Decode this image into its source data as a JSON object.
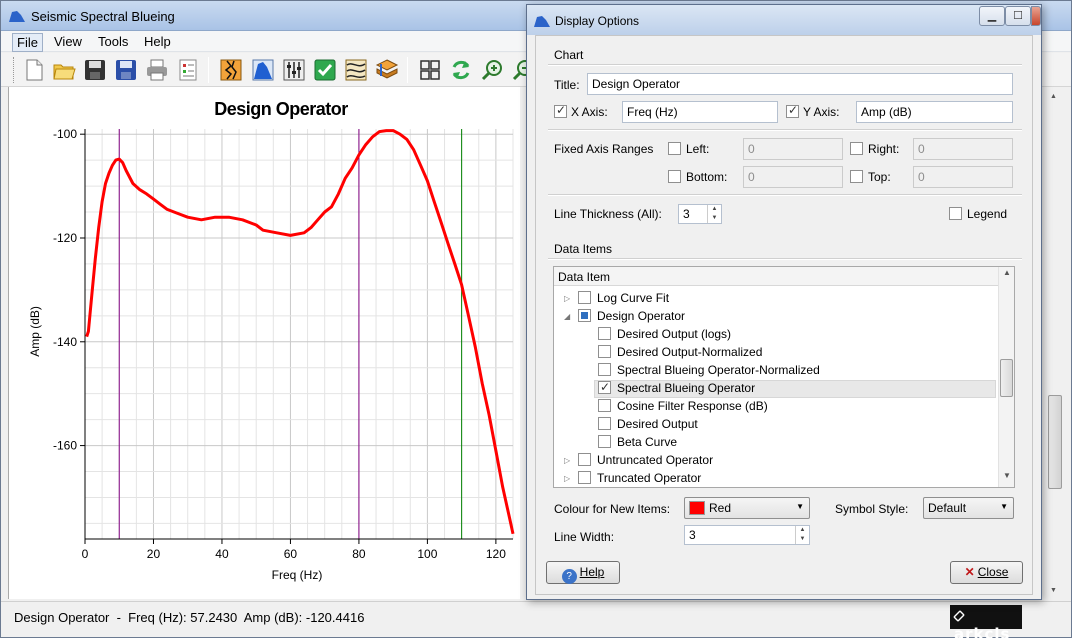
{
  "window": {
    "title": "Seismic Spectral Blueing"
  },
  "menu": {
    "file": "File",
    "view": "View",
    "tools": "Tools",
    "help": "Help"
  },
  "toolbar": {
    "buttons": [
      "new-file-icon",
      "open-folder-icon",
      "save-icon",
      "save-as-icon",
      "print-icon",
      "properties-icon",
      "seismic-trace-icon",
      "spectrum-icon",
      "sliders-icon",
      "checkmark-icon",
      "curves-icon",
      "layers-icon",
      "grid-view-icon",
      "refresh-icon",
      "zoom-in-icon",
      "zoom-out-icon"
    ]
  },
  "chart_data": {
    "type": "line",
    "title": "Design Operator",
    "xlabel": "Freq (Hz)",
    "ylabel": "Amp (dB)",
    "xlim": [
      0,
      125
    ],
    "ylim": [
      -178,
      -99
    ],
    "xticks": [
      0,
      20,
      40,
      60,
      80,
      100,
      120
    ],
    "yticks": [
      -100,
      -120,
      -140,
      -160
    ],
    "grid": true,
    "vlines": [
      {
        "x": 0,
        "color": "#800080"
      },
      {
        "x": 10,
        "color": "#800080"
      },
      {
        "x": 80,
        "color": "#800080"
      },
      {
        "x": 110,
        "color": "#008000"
      }
    ],
    "series": [
      {
        "color": "#ff0000",
        "x": [
          0.5,
          1,
          2,
          3,
          4,
          5,
          6,
          7,
          8,
          9,
          10,
          11,
          12,
          14,
          16,
          18,
          20,
          22,
          24,
          26,
          28,
          30,
          34,
          38,
          42,
          46,
          50,
          52,
          56,
          60,
          64,
          66,
          68,
          70,
          72,
          74,
          76,
          78,
          80,
          82,
          84,
          86,
          88,
          90,
          92,
          94,
          96,
          98,
          100,
          102,
          104,
          106,
          108,
          110,
          112,
          114,
          116,
          118,
          120,
          122,
          124,
          125
        ],
        "y": [
          -139,
          -138,
          -131,
          -124,
          -118,
          -113,
          -109.5,
          -107.5,
          -106,
          -105,
          -104.8,
          -105.5,
          -107,
          -109.5,
          -110.7,
          -111.5,
          -112.5,
          -113.5,
          -114.5,
          -115,
          -115.5,
          -116,
          -116.5,
          -116,
          -116,
          -116.5,
          -117.5,
          -118.5,
          -119,
          -119.5,
          -119,
          -118,
          -116.5,
          -115,
          -114,
          -111.5,
          -108.5,
          -106.5,
          -104,
          -102,
          -100.5,
          -99.5,
          -99.3,
          -99.3,
          -100,
          -101,
          -103,
          -106,
          -109,
          -113,
          -117,
          -121,
          -125,
          -129,
          -135,
          -141,
          -148,
          -154,
          -161,
          -168,
          -174,
          -177
        ]
      }
    ]
  },
  "status": {
    "text": "Design Operator  -  Freq (Hz): 57.2430  Amp (dB): -120.4416"
  },
  "brand": {
    "text": "arkcls"
  },
  "dialog": {
    "title": "Display Options",
    "chart_group": "Chart",
    "title_label": "Title:",
    "title_value": "Design Operator",
    "x_axis_label": "X Axis:",
    "x_axis_value": "Freq (Hz)",
    "y_axis_label": "Y Axis:",
    "y_axis_value": "Amp (dB)",
    "fixed_ranges_label": "Fixed Axis Ranges",
    "left_label": "Left:",
    "left_value": "0",
    "right_label": "Right:",
    "right_value": "0",
    "bottom_label": "Bottom:",
    "bottom_value": "0",
    "top_label": "Top:",
    "top_value": "0",
    "line_thickness_label": "Line Thickness (All):",
    "line_thickness_value": "3",
    "legend_label": "Legend",
    "data_items_group": "Data Items",
    "tree_header": "Data Item",
    "tree_items": [
      {
        "label": "Log Curve Fit",
        "level": 0,
        "expander": "collapsed",
        "check": "none"
      },
      {
        "label": "Design Operator",
        "level": 0,
        "expander": "expanded",
        "check": "partial"
      },
      {
        "label": "Desired Output (logs)",
        "level": 1,
        "check": "none"
      },
      {
        "label": "Desired Output-Normalized",
        "level": 1,
        "check": "none"
      },
      {
        "label": "Spectral Blueing Operator-Normalized",
        "level": 1,
        "check": "none"
      },
      {
        "label": "Spectral Blueing Operator",
        "level": 1,
        "check": "checked",
        "selected": true
      },
      {
        "label": "Cosine Filter Response (dB)",
        "level": 1,
        "check": "none"
      },
      {
        "label": "Desired Output",
        "level": 1,
        "check": "none"
      },
      {
        "label": "Beta Curve",
        "level": 1,
        "check": "none"
      },
      {
        "label": "Untruncated Operator",
        "level": 0,
        "expander": "collapsed",
        "check": "none"
      },
      {
        "label": "Truncated Operator",
        "level": 0,
        "expander": "collapsed",
        "check": "none"
      }
    ],
    "colour_label": "Colour for New Items:",
    "colour_value": "Red",
    "colour_hex": "#ff0000",
    "symbol_label": "Symbol Style:",
    "symbol_value": "Default",
    "line_width_label": "Line Width:",
    "line_width_value": "3",
    "help_button": "Help",
    "close_button": "Close"
  }
}
